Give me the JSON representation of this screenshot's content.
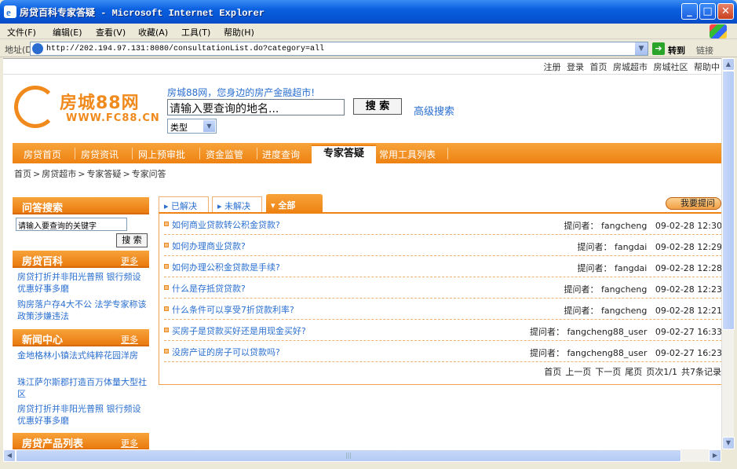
{
  "window": {
    "title": "房贷百科专家答疑 - Microsoft Internet Explorer"
  },
  "menu": [
    "文件(F)",
    "编辑(E)",
    "查看(V)",
    "收藏(A)",
    "工具(T)",
    "帮助(H)"
  ],
  "address": {
    "label": "地址(D)",
    "url": "http://202.194.97.131:8080/consultationList.do?category=all",
    "go": "转到",
    "links": "链接"
  },
  "toplinks": [
    "注册",
    "登录",
    "首页",
    "房城超市",
    "房城社区",
    "帮助中"
  ],
  "header": {
    "logo_text": "房城88网",
    "logo_url": "WWW.FC88.CN",
    "slogan": "房城88网，您身边的房产金融超市!",
    "search_placeholder": "请输入要查询的地名...",
    "search_button": "搜 索",
    "advanced_search": "高级搜索",
    "type_select": "类型"
  },
  "nav": {
    "items": [
      "房贷首页",
      "房贷资讯",
      "网上预审批",
      "资金监管",
      "进度查询",
      "常用工具列表"
    ],
    "active": "专家答疑"
  },
  "breadcrumb": [
    "首页",
    ">",
    "房贷超市",
    ">",
    "专家答疑",
    ">",
    "专家问答"
  ],
  "left": {
    "qa_search": {
      "title": "问答搜索",
      "placeholder": "请输入要查询的关键字",
      "button": "搜 索"
    },
    "baike": {
      "title": "房贷百科",
      "more": "更多",
      "items": [
        "房贷打折并非阳光普照 银行频设优惠好事多磨",
        "购房落户存4大不公 法学专家称该政策涉嫌违法"
      ]
    },
    "news": {
      "title": "新闻中心",
      "more": "更多",
      "items": [
        "金地格林小镇法式纯粹花园洋房",
        "珠江萨尔斯郡打造百万体量大型社区",
        "房贷打折并非阳光普照 银行频设优惠好事多磨"
      ]
    },
    "products": {
      "title": "房贷产品列表",
      "more": "更多"
    }
  },
  "tabs": {
    "solved": "已解决",
    "unsolved": "未解决",
    "all": "全部",
    "ask": "我要提问"
  },
  "questions": [
    {
      "title": "如何商业贷款转公积金贷款?",
      "asker_label": "提问者：",
      "asker": "fangcheng",
      "time": "09-02-28 12:30"
    },
    {
      "title": "如何办理商业贷款?",
      "asker_label": "提问者：",
      "asker": "fangdai",
      "time": "09-02-28 12:29"
    },
    {
      "title": "如何办理公积金贷款是手续?",
      "asker_label": "提问者：",
      "asker": "fangdai",
      "time": "09-02-28 12:28"
    },
    {
      "title": "什么是存抵贷贷款?",
      "asker_label": "提问者：",
      "asker": "fangcheng",
      "time": "09-02-28 12:23"
    },
    {
      "title": "什么条件可以享受7折贷款利率?",
      "asker_label": "提问者：",
      "asker": "fangcheng",
      "time": "09-02-28 12:21"
    },
    {
      "title": "买房子是贷款买好还是用现金买好?",
      "asker_label": "提问者：",
      "asker": "fangcheng88_user",
      "time": "09-02-27 16:33"
    },
    {
      "title": "没房产证的房子可以贷款吗?",
      "asker_label": "提问者：",
      "asker": "fangcheng88_user",
      "time": "09-02-27 16:23"
    }
  ],
  "pager": [
    "首页",
    "上一页",
    "下一页",
    "尾页",
    "页次1/1",
    "共7条记录"
  ]
}
